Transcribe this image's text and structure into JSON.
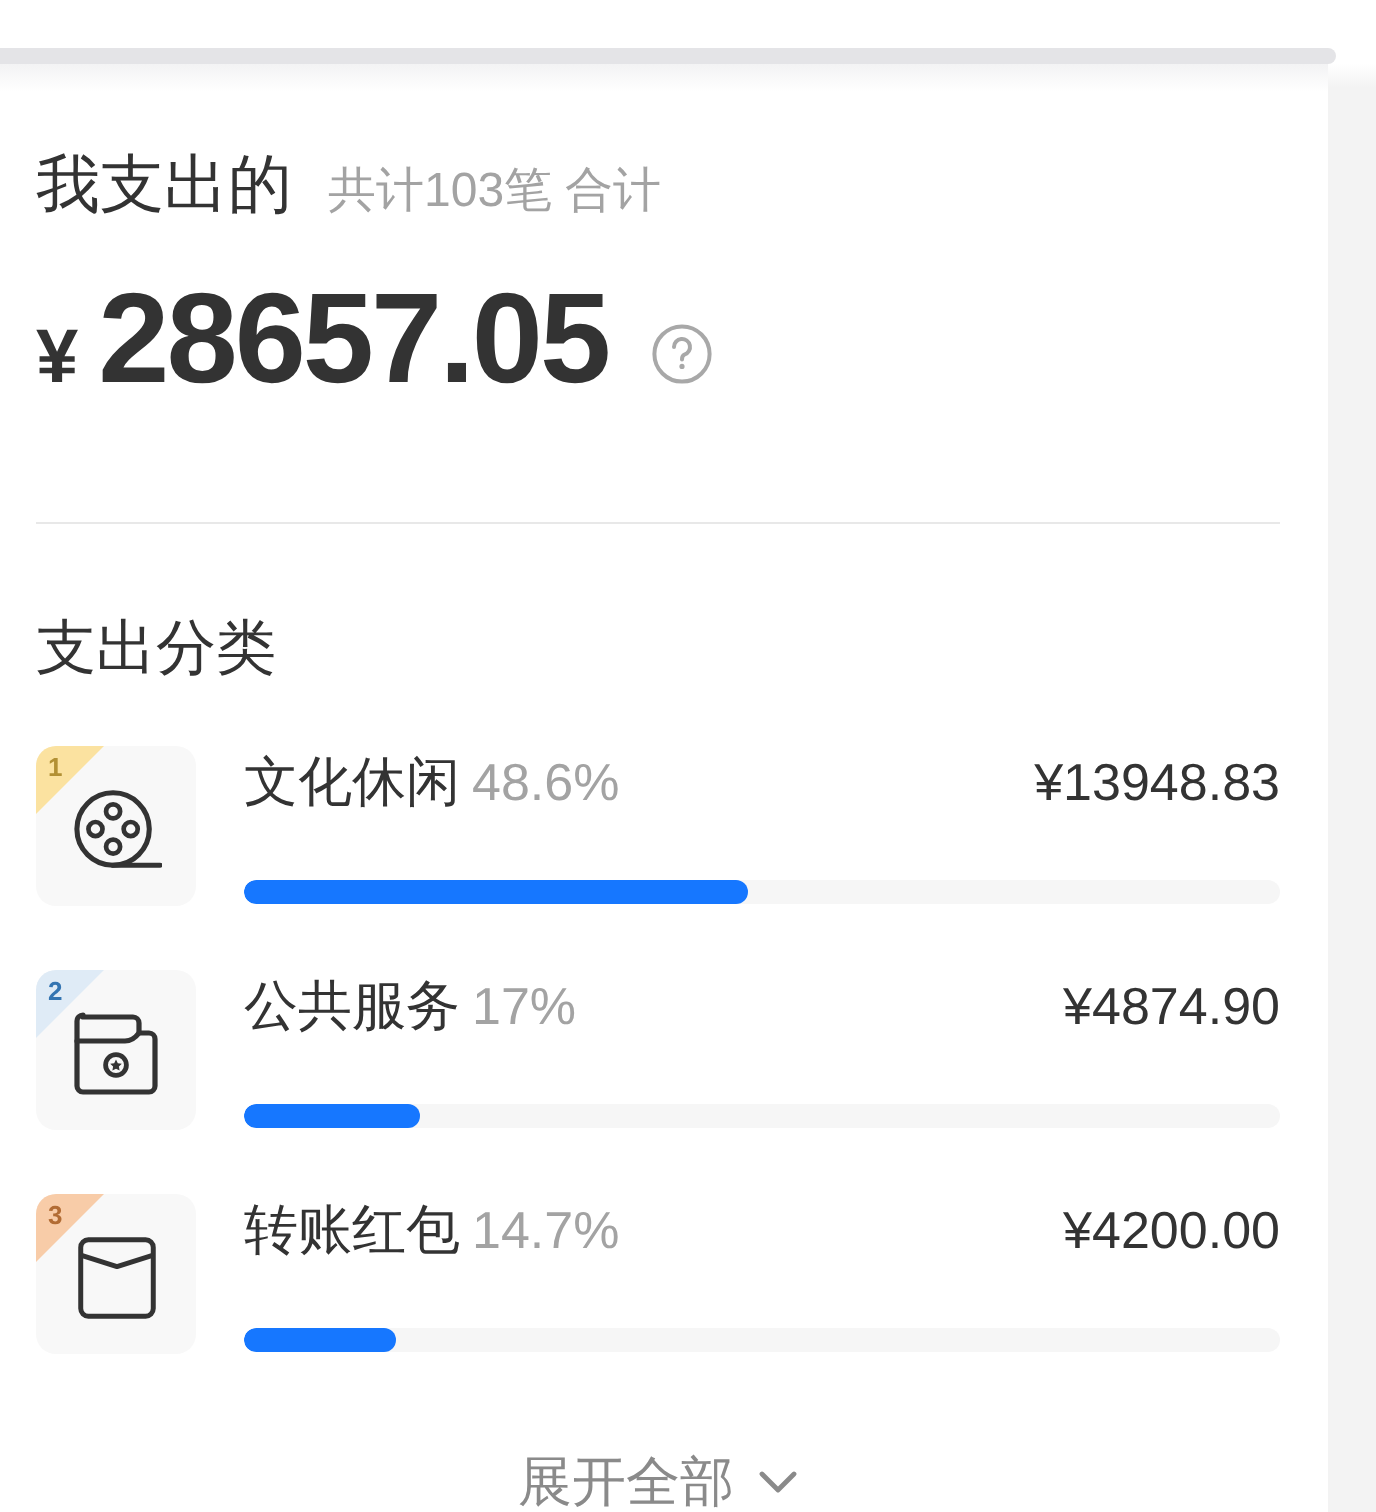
{
  "summary": {
    "title": "我支出的",
    "subtitle": "共计103笔 合计",
    "currency": "¥",
    "amount": "28657.05"
  },
  "categories": {
    "title": "支出分类",
    "items": [
      {
        "rank": "1",
        "color": "#fbe2a0",
        "name": "文化休闲",
        "percent": "48.6%",
        "amount": "¥13948.83",
        "level": 0.486
      },
      {
        "rank": "2",
        "color": "#dfebf6",
        "name": "公共服务",
        "percent": "17%",
        "amount": "¥4874.90",
        "level": 0.17
      },
      {
        "rank": "3",
        "color": "#f8cca8",
        "name": "转账红包",
        "percent": "14.7%",
        "amount": "¥4200.00",
        "level": 0.147
      }
    ]
  },
  "expand": {
    "label": "展开全部"
  }
}
